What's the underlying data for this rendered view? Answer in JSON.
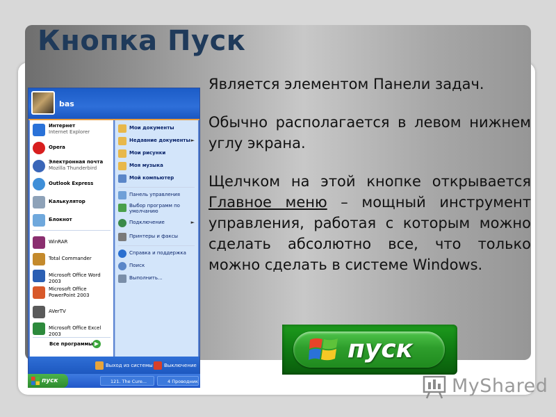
{
  "slide": {
    "title": "Кнопка Пуск",
    "paragraphs": [
      "Является элементом Панели задач.",
      "Обычно располагается в левом нижнем углу экрана."
    ],
    "para3_before": "Щелчком на этой кнопке открывается ",
    "para3_link": "Главное меню",
    "para3_after": " – мощный инструмент управления, работая с которым можно сделать абсолютно все, что только можно сделать в системе Windows."
  },
  "start_menu": {
    "user": "bas",
    "left_items": [
      {
        "label": "Интернет",
        "sub": "Internet Explorer",
        "icon": "internet-explorer-icon",
        "color": "#2a72d8"
      },
      {
        "label": "Opera",
        "sub": "",
        "icon": "opera-icon",
        "color": "#d81e1e"
      },
      {
        "label": "Электронная почта",
        "sub": "Mozilla Thunderbird",
        "icon": "thunderbird-icon",
        "color": "#3a66b8"
      },
      {
        "label": "Outlook Express",
        "sub": "",
        "icon": "outlook-express-icon",
        "color": "#3f8fd8"
      },
      {
        "label": "Калькулятор",
        "sub": "",
        "icon": "calculator-icon",
        "color": "#8ea2b8"
      },
      {
        "label": "Блокнот",
        "sub": "",
        "icon": "notepad-icon",
        "color": "#6fa8dc"
      },
      {
        "label": "WinRAR",
        "sub": "",
        "icon": "winrar-icon",
        "color": "#8b2f6f"
      },
      {
        "label": "Total Commander",
        "sub": "",
        "icon": "total-commander-icon",
        "color": "#c48a2c"
      },
      {
        "label": "Microsoft Office Word 2003",
        "sub": "",
        "icon": "word-icon",
        "color": "#2b5fb3"
      },
      {
        "label": "Microsoft Office PowerPoint 2003",
        "sub": "",
        "icon": "powerpoint-icon",
        "color": "#d8592a"
      },
      {
        "label": "AVerTV",
        "sub": "",
        "icon": "avertv-icon",
        "color": "#5a5a5a"
      },
      {
        "label": "Microsoft Office Excel 2003",
        "sub": "",
        "icon": "excel-icon",
        "color": "#2d8a3c"
      }
    ],
    "all_programs": "Все программы",
    "right_items": [
      {
        "label": "Мои документы",
        "arrow": "",
        "icon": "my-documents-icon",
        "color": "#e8b84a"
      },
      {
        "label": "Недавние документы",
        "arrow": "►",
        "icon": "recent-documents-icon",
        "color": "#e8b84a"
      },
      {
        "label": "Мои рисунки",
        "arrow": "",
        "icon": "my-pictures-icon",
        "color": "#e8b84a"
      },
      {
        "label": "Моя музыка",
        "arrow": "",
        "icon": "my-music-icon",
        "color": "#e8b84a"
      },
      {
        "label": "Мой компьютер",
        "arrow": "",
        "icon": "my-computer-icon",
        "color": "#5a86c8"
      },
      {
        "label": "Панель управления",
        "arrow": "",
        "icon": "control-panel-icon",
        "color": "#6fa0d8"
      },
      {
        "label": "Выбор программ по умолчанию",
        "arrow": "",
        "icon": "default-programs-icon",
        "color": "#4aa04a"
      },
      {
        "label": "Подключение",
        "arrow": "►",
        "icon": "network-connections-icon",
        "color": "#3a8a4a"
      },
      {
        "label": "Принтеры и факсы",
        "arrow": "",
        "icon": "printers-icon",
        "color": "#7a7a7a"
      },
      {
        "label": "Справка и поддержка",
        "arrow": "",
        "icon": "help-icon",
        "color": "#2a6fd0"
      },
      {
        "label": "Поиск",
        "arrow": "",
        "icon": "search-icon",
        "color": "#5a86c8"
      },
      {
        "label": "Выполнить...",
        "arrow": "",
        "icon": "run-icon",
        "color": "#7a8ea8"
      }
    ],
    "logoff": "Выход из системы",
    "shutdown": "Выключение"
  },
  "taskbar": {
    "start_label": "пуск",
    "tasks": [
      "121. The Cure...",
      "4 Проводник"
    ]
  },
  "big_start": {
    "label": "пуск"
  },
  "watermark": {
    "text": "MyShared"
  }
}
